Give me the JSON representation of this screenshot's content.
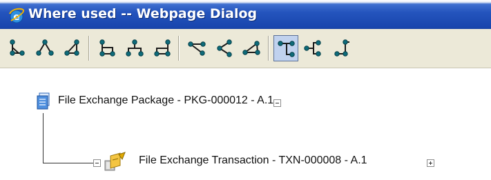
{
  "window": {
    "title": "Where used -- Webpage Dialog",
    "titlebar_icon": "internet-explorer-icon"
  },
  "toolbar": {
    "buttons": [
      {
        "icon": "tree-layout-down-right-icon",
        "active": false
      },
      {
        "icon": "tree-layout-down-centered-icon",
        "active": false
      },
      {
        "icon": "tree-layout-down-left-icon",
        "active": false
      },
      {
        "icon": "tree-layout-bracket-right-icon",
        "active": false
      },
      {
        "icon": "tree-layout-bracket-centered-icon",
        "active": false
      },
      {
        "icon": "tree-layout-bracket-left-icon",
        "active": false
      },
      {
        "icon": "tree-layout-right-down-icon",
        "active": false
      },
      {
        "icon": "tree-layout-left-icon",
        "active": false
      },
      {
        "icon": "tree-layout-left-up-icon",
        "active": false
      },
      {
        "icon": "tree-layout-vertical-branch-icon",
        "active": true
      },
      {
        "icon": "tree-layout-vertical-left-icon",
        "active": false
      },
      {
        "icon": "tree-layout-vertical-right-icon",
        "active": false
      }
    ]
  },
  "tree": {
    "root": {
      "label": "File Exchange Package - PKG-000012 - A.1",
      "icon": "package-document-icon",
      "expander_state": "expanded",
      "children": [
        {
          "label": "File Exchange Transaction - TXN-000008 - A.1",
          "icon": "transaction-icon",
          "left_expander_state": "expanded",
          "right_expander_state": "collapsed"
        }
      ]
    }
  },
  "colors": {
    "titlebar": "#1f4fb8",
    "toolbar_bg": "#ece9d8",
    "active_button": "#c1d2ee",
    "node_dot": "#0e6b7a"
  }
}
